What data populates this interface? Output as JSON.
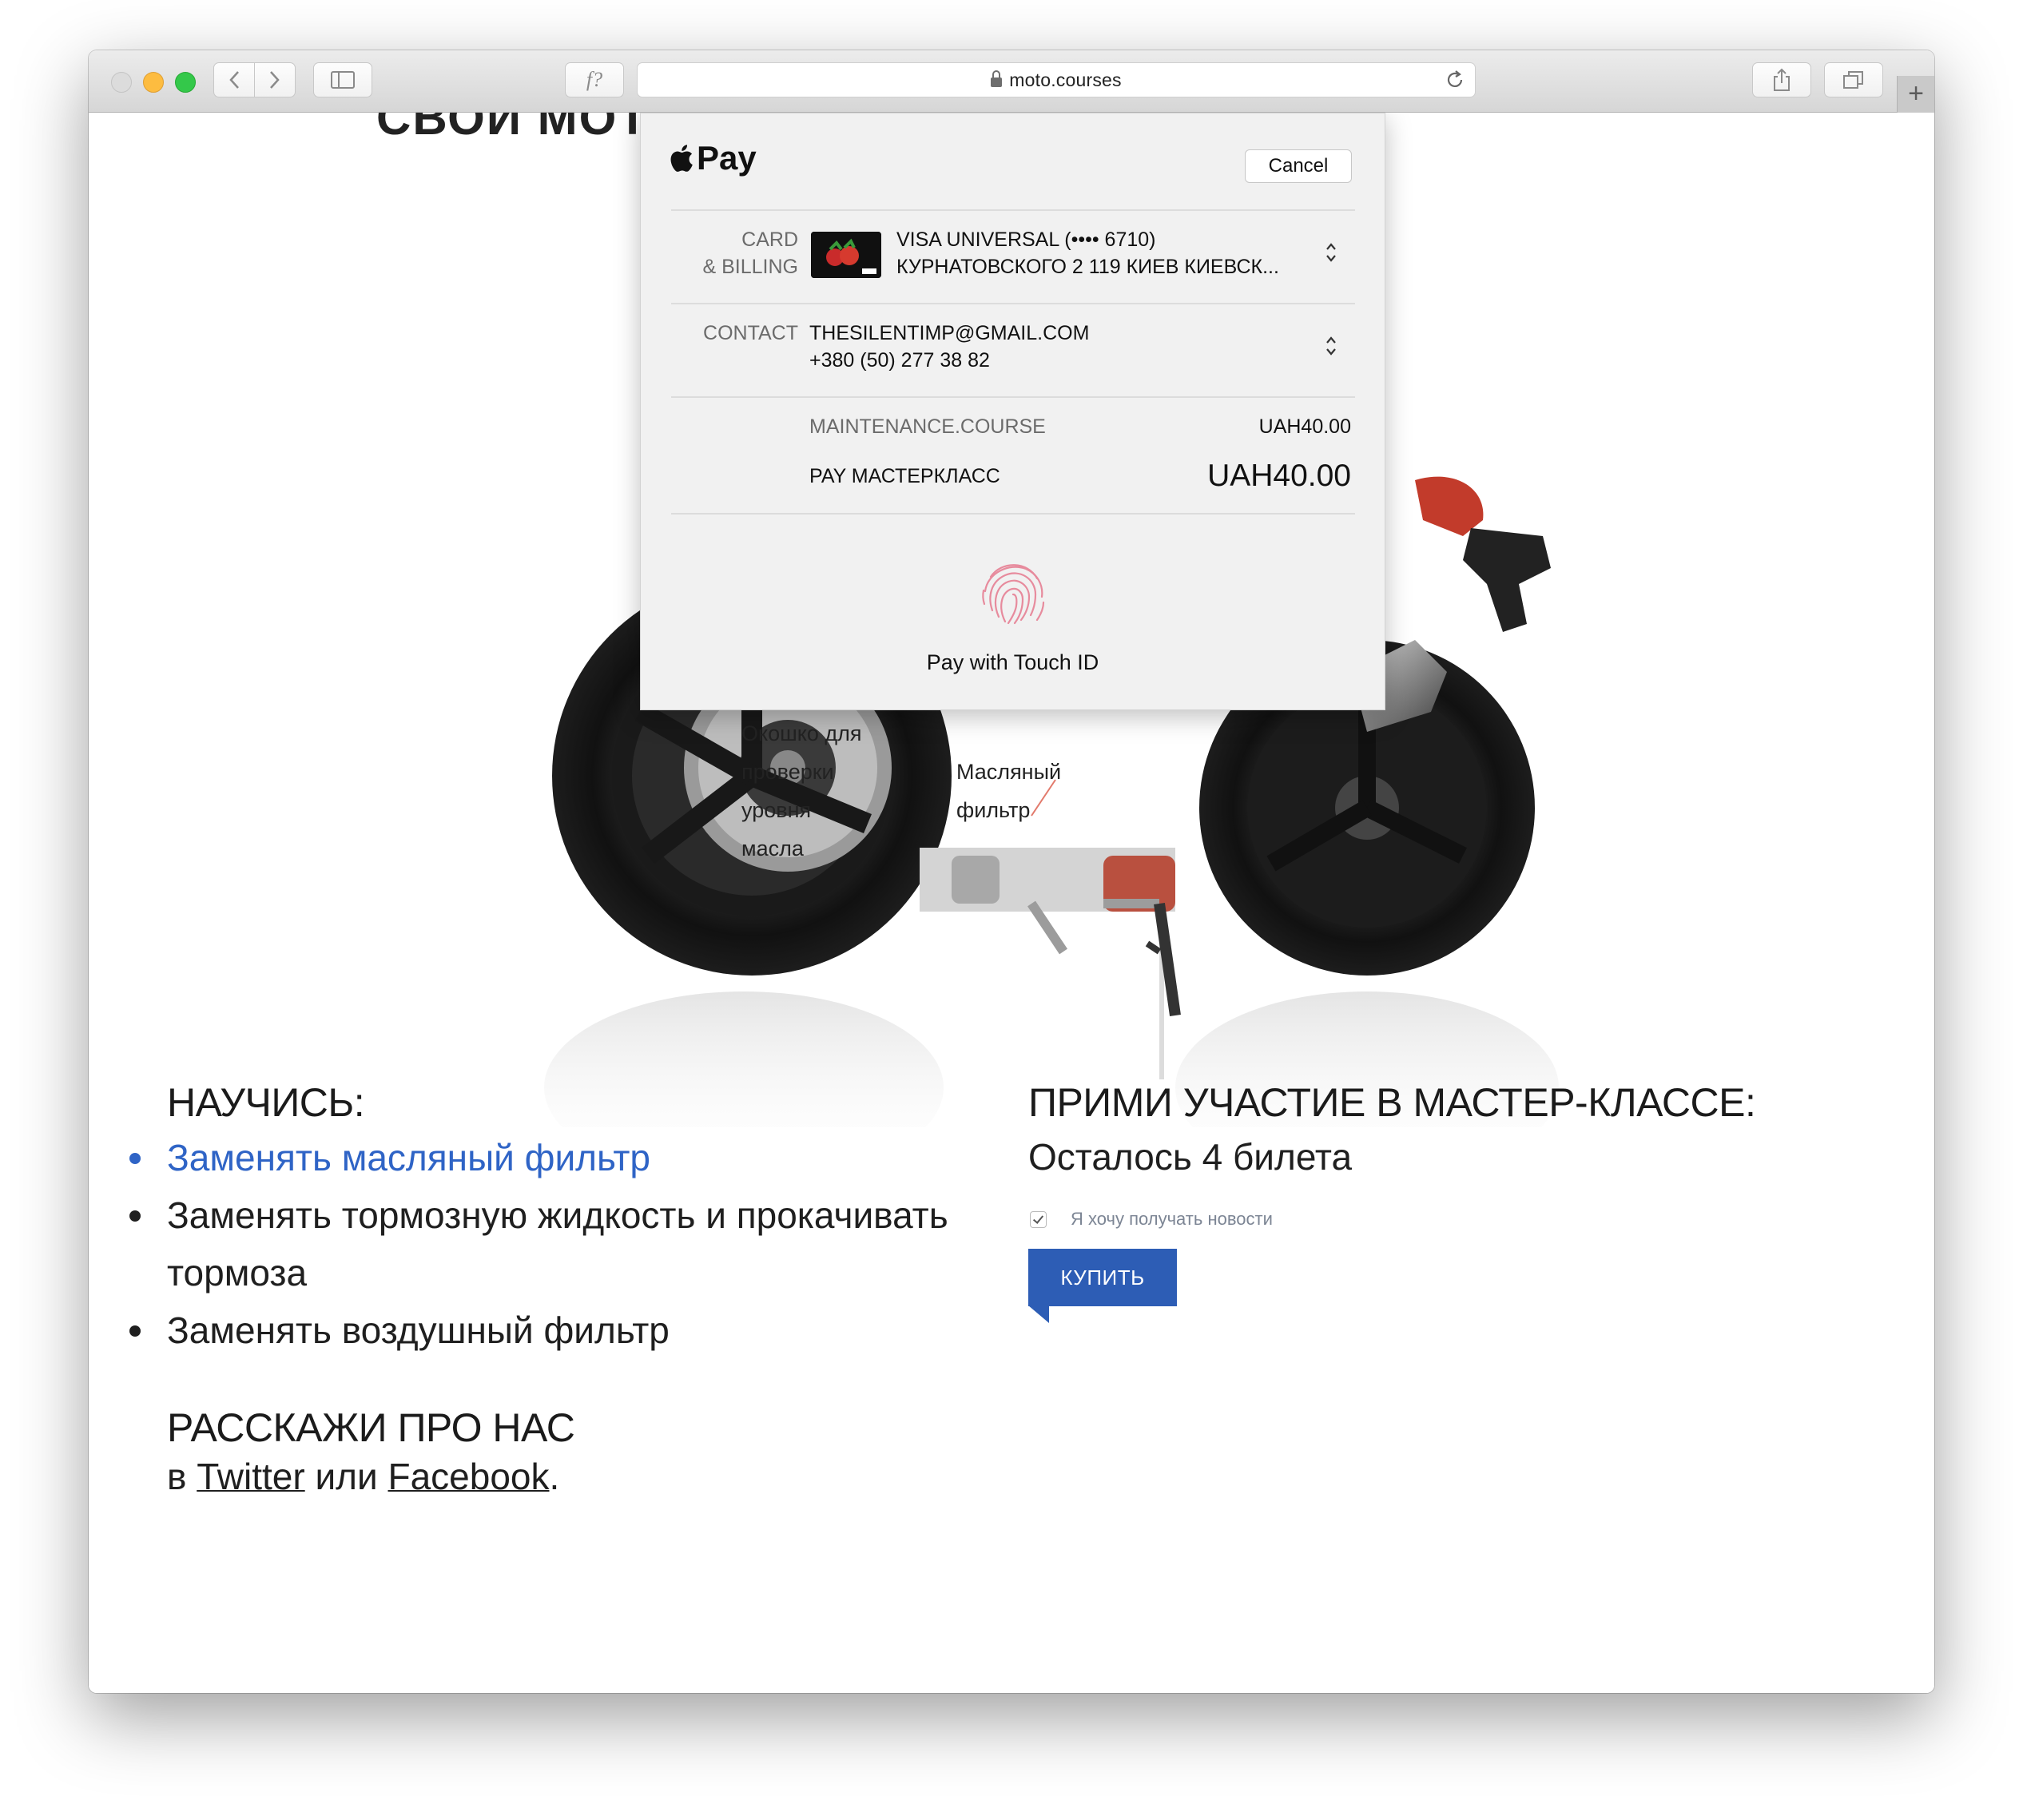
{
  "browser": {
    "url": "moto.courses",
    "new_tab": "+",
    "reader_glyph": "f?"
  },
  "page": {
    "partial_heading": "СВОИ МОТОЦ",
    "annotations": {
      "oil_window": [
        "Окошко для",
        "проверки",
        "уровня",
        "масла"
      ],
      "oil_filter": [
        "Масляный",
        "фильтр"
      ]
    },
    "learn": {
      "title": "НАУЧИСЬ:",
      "items": [
        "Заменять масляный фильтр",
        "Заменять тормозную жидкость и прокачивать тормоза",
        "Заменять воздушный фильтр"
      ]
    },
    "tell": {
      "title": "РАССКАЖИ ПРО НАС",
      "prefix": "в ",
      "twitter": "Twitter",
      "middle": " или ",
      "facebook": "Facebook",
      "suffix": "."
    },
    "join": {
      "title": "ПРИМИ УЧАСТИЕ В МАСТЕР-КЛАССЕ:",
      "tickets": "Осталось 4 билета",
      "newsletter_label": "Я хочу получать новости",
      "newsletter_checked": true,
      "buy_label": "КУПИТЬ",
      "accent": "#2d5db5"
    }
  },
  "apple_pay": {
    "brand": "Pay",
    "cancel": "Cancel",
    "card": {
      "label_line1": "CARD",
      "label_line2": "& BILLING",
      "name": "VISA UNIVERSAL (•••• 6710)",
      "address": "КУРНАТОВСКОГО 2 119 КИЕВ КИЕВСК..."
    },
    "contact": {
      "label": "CONTACT",
      "email": "THESILENTIMP@GMAIL.COM",
      "phone": "+380 (50) 277 38 82"
    },
    "summary": {
      "line_item": "MAINTENANCE.COURSE",
      "line_amount": "UAH40.00",
      "pay_label": "PAY МАСТЕРКЛАСС",
      "total": "UAH40.00"
    },
    "touch_id": "Pay with Touch ID"
  }
}
